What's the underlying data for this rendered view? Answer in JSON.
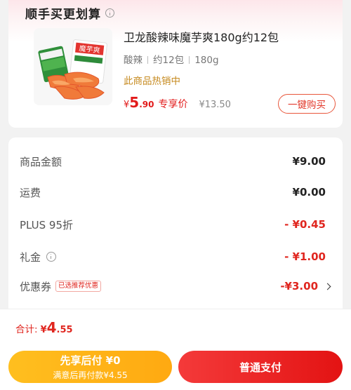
{
  "recommend": {
    "title": "顺手买更划算",
    "product": {
      "name": "卫龙酸辣味魔芋爽180g约12包",
      "specs": [
        "酸辣",
        "约12包",
        "180g"
      ],
      "hot_label": "此商品热销中",
      "price_symbol": "¥",
      "price_int": "5",
      "price_dec": ".90",
      "exclusive_label": "专享价",
      "original_price": "¥13.50",
      "buy_button": "一键购买",
      "image_text": "魔芋爽"
    }
  },
  "summary": {
    "rows": [
      {
        "label": "商品金额",
        "value": "¥9.00"
      },
      {
        "label": "运费",
        "value": "¥0.00"
      },
      {
        "label": "PLUS 95折",
        "value": "- ¥0.45"
      },
      {
        "label": "礼金",
        "value": "- ¥1.00"
      },
      {
        "label": "优惠券",
        "tag": "已选推荐优惠",
        "value": "-¥3.00"
      }
    ]
  },
  "total": {
    "label": "合计:",
    "symbol": "¥",
    "int": "4",
    "dec": ".55"
  },
  "actions": {
    "pay_later_title": "先享后付 ¥0",
    "pay_later_sub": "满意后再付款¥4.55",
    "pay_now": "普通支付"
  },
  "colors": {
    "accent_red": "#e0261f",
    "hot_gold": "#c68a1f",
    "pay_later": "#ffb318",
    "pay_now": "#ea1f1f"
  }
}
